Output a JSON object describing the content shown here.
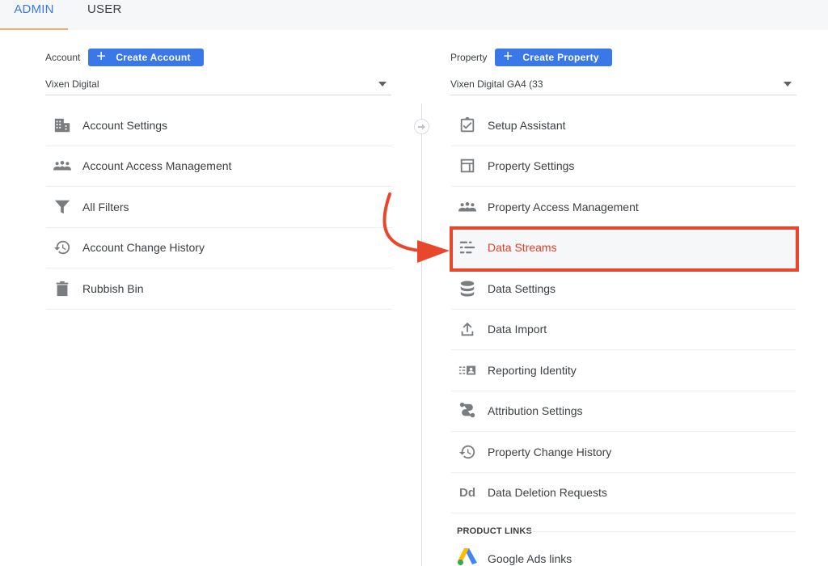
{
  "tabs": [
    {
      "label": "ADMIN",
      "active": true
    },
    {
      "label": "USER",
      "active": false
    }
  ],
  "account": {
    "label": "Account",
    "create_button": "Create Account",
    "selected": "Vixen Digital",
    "items": [
      {
        "label": "Account Settings",
        "icon": "building-icon"
      },
      {
        "label": "Account Access Management",
        "icon": "people-icon"
      },
      {
        "label": "All Filters",
        "icon": "filter-icon"
      },
      {
        "label": "Account Change History",
        "icon": "history-icon"
      },
      {
        "label": "Rubbish Bin",
        "icon": "trash-icon"
      }
    ]
  },
  "property": {
    "label": "Property",
    "create_button": "Create Property",
    "selected": "Vixen Digital GA4 (33",
    "items": [
      {
        "label": "Setup Assistant",
        "icon": "clipboard-check-icon"
      },
      {
        "label": "Property Settings",
        "icon": "layout-icon"
      },
      {
        "label": "Property Access Management",
        "icon": "people-icon"
      },
      {
        "label": "Data Streams",
        "icon": "data-streams-icon",
        "active": true
      },
      {
        "label": "Data Settings",
        "icon": "database-icon"
      },
      {
        "label": "Data Import",
        "icon": "upload-icon"
      },
      {
        "label": "Reporting Identity",
        "icon": "reporting-identity-icon"
      },
      {
        "label": "Attribution Settings",
        "icon": "attribution-icon"
      },
      {
        "label": "Property Change History",
        "icon": "history-icon"
      },
      {
        "label": "Data Deletion Requests",
        "icon": "dd-icon",
        "icon_text": "Dd"
      }
    ],
    "product_links": {
      "title": "PRODUCT LINKS",
      "items": [
        {
          "label": "Google Ads links",
          "icon": "google-ads-icon"
        }
      ]
    }
  },
  "annotation": {
    "highlight_color": "#e8472c",
    "target": "Data Streams"
  },
  "colors": {
    "accent": "#3b78e7",
    "tab_underline": "#f6ad6b",
    "active_text": "#e33d25"
  }
}
